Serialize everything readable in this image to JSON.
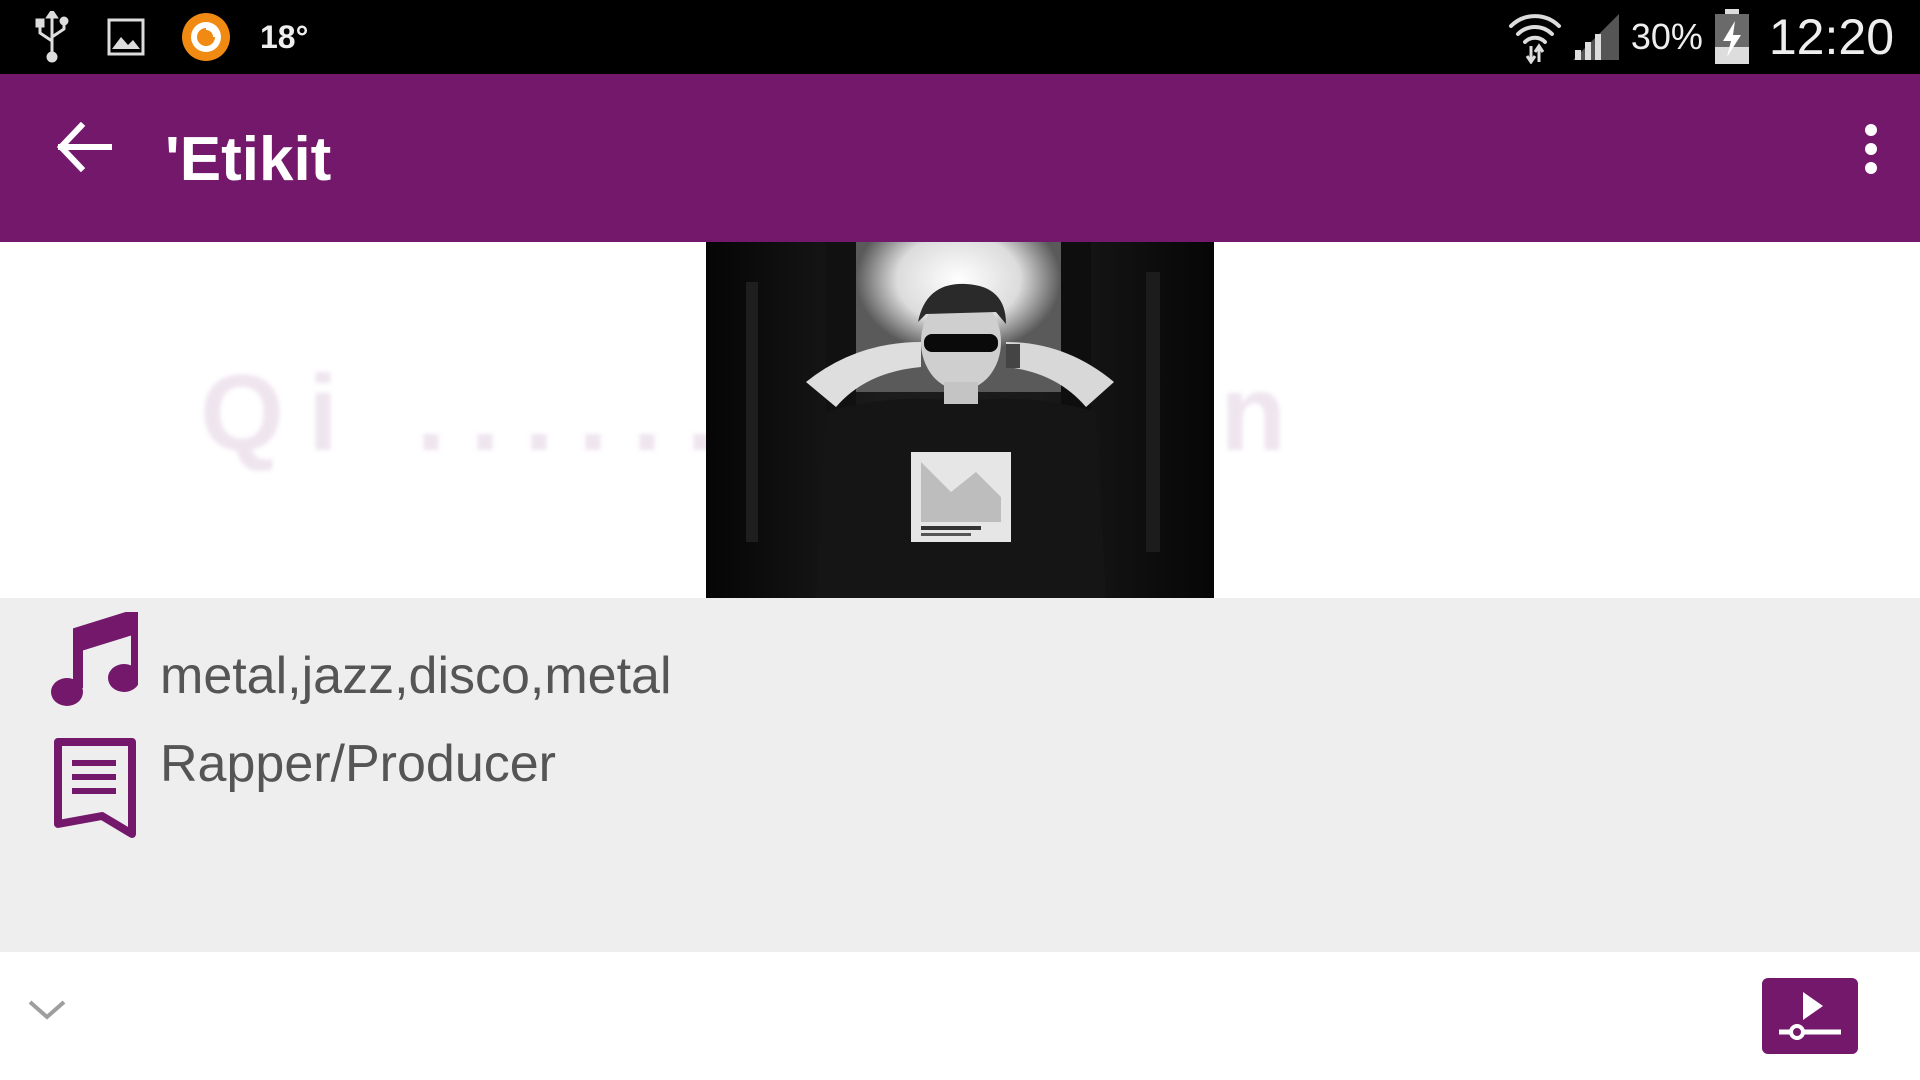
{
  "status_bar": {
    "icons_left": [
      "usb-icon",
      "image-icon",
      "circle-app-icon"
    ],
    "temperature": "18°",
    "icons_right": [
      "wifi-icon",
      "cell-signal-icon",
      "battery-charging-icon"
    ],
    "battery": "30%",
    "time": "12:20"
  },
  "app_bar": {
    "title": "'Etikit",
    "back_icon": "arrow-back-icon",
    "overflow_icon": "more-vert-icon",
    "color": "#74186c"
  },
  "artwork": {
    "watermark": "Qi  ........cation",
    "photo": "artist-photo"
  },
  "info": {
    "genres": "metal,jazz,disco,metal",
    "genres_icon": "music-note-icon",
    "role": "Rapper/Producer",
    "role_icon": "description-icon",
    "icon_color": "#74186c"
  },
  "bottom_bar": {
    "expand_icon": "chevron-down-icon",
    "player_icon": "play-slider-icon"
  }
}
